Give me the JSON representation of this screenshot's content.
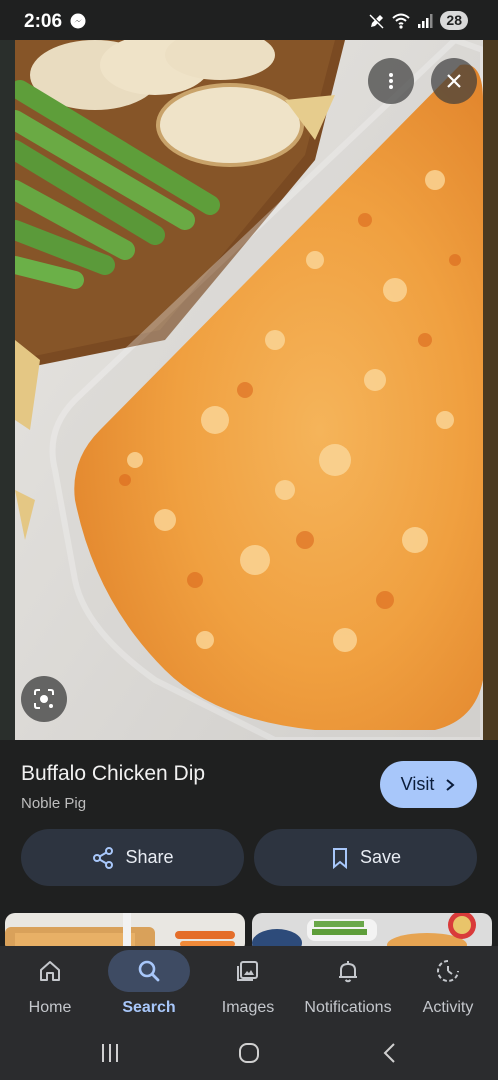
{
  "status_bar": {
    "time": "2:06",
    "battery": "28",
    "icons": [
      "messenger-icon",
      "pen-off-icon",
      "wifi-icon",
      "signal-icon"
    ]
  },
  "hero": {
    "image_subject": "Buffalo chicken dip in glass baking dish with celery and bread",
    "more_icon": "more-vert-icon",
    "close_icon": "close-icon",
    "lens_icon": "lens-icon"
  },
  "result": {
    "title": "Buffalo Chicken Dip",
    "source": "Noble Pig",
    "visit_label": "Visit",
    "share_label": "Share",
    "save_label": "Save"
  },
  "nav": {
    "items": [
      {
        "label": "Home",
        "icon": "home-icon"
      },
      {
        "label": "Search",
        "icon": "search-icon"
      },
      {
        "label": "Images",
        "icon": "images-icon"
      },
      {
        "label": "Notifications",
        "icon": "bell-icon"
      },
      {
        "label": "Activity",
        "icon": "activity-icon"
      }
    ],
    "active": "Search"
  },
  "colors": {
    "background": "#1f2020",
    "accent": "#a8c7fa",
    "button_bg": "#2d3440",
    "nav_bg": "#2b2c2e"
  }
}
